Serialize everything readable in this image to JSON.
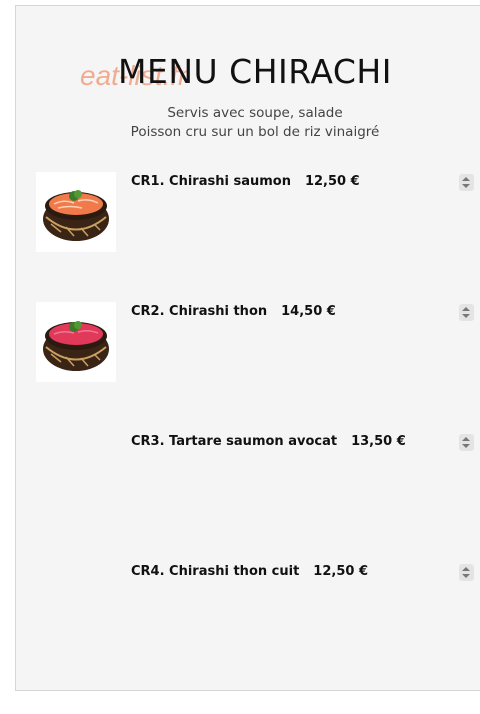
{
  "header": {
    "title": "MENU CHIRACHI",
    "watermark": "eat-list.fr",
    "subtitle_line1": "Servis avec soupe, salade",
    "subtitle_line2": "Poisson cru sur un bol de riz vinaigré"
  },
  "items": [
    {
      "name": "CR1. Chirashi saumon",
      "price": "12,50 €",
      "image": "chirashi-saumon-bowl",
      "fish_color": "#f07a4a"
    },
    {
      "name": "CR2. Chirashi thon",
      "price": "14,50 €",
      "image": "chirashi-thon-bowl",
      "fish_color": "#e0395a"
    },
    {
      "name": "CR3. Tartare saumon avocat",
      "price": "13,50 €"
    },
    {
      "name": "CR4. Chirashi thon cuit",
      "price": "12,50 €"
    }
  ],
  "icons": {
    "stepper": "quantity-stepper-icon"
  }
}
